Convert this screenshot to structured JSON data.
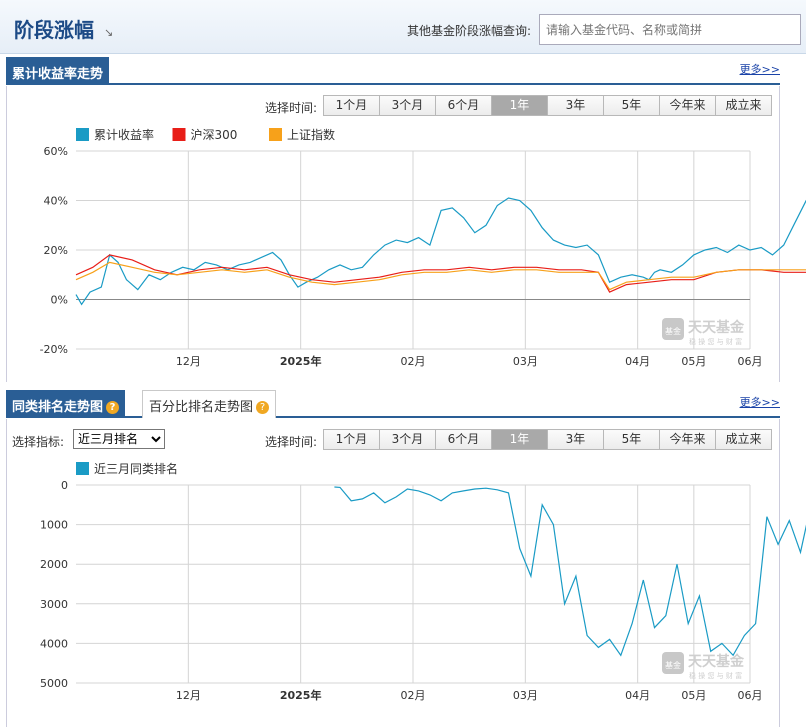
{
  "header": {
    "title": "阶段涨幅",
    "title_arrow": "↘",
    "search_label": "其他基金阶段涨幅查询:",
    "search_placeholder": "请输入基金代码、名称或简拼"
  },
  "section1": {
    "tab": "累计收益率走势",
    "more": "更多>>",
    "time_label": "选择时间:",
    "time_buttons": [
      "1个月",
      "3个月",
      "6个月",
      "1年",
      "3年",
      "5年",
      "今年来",
      "成立来"
    ],
    "active_button": "1年"
  },
  "section2": {
    "tab_active": "同类排名走势图",
    "tab_inactive": "百分比排名走势图",
    "more": "更多>>",
    "indicator_label": "选择指标:",
    "indicator_value": "近三月排名",
    "time_label": "选择时间:",
    "time_buttons": [
      "1个月",
      "3个月",
      "6个月",
      "1年",
      "3年",
      "5年",
      "今年来",
      "成立来"
    ],
    "active_button": "1年"
  },
  "watermark": {
    "brand": "天天基金",
    "badge": "基金",
    "slogan": "稳 操 您 与 财 富"
  },
  "chart_data": [
    {
      "type": "line",
      "legend_position": "top-left",
      "xlim": [
        0,
        12
      ],
      "ylim": [
        -20,
        60
      ],
      "y_ticks": [
        -20,
        0,
        20,
        40,
        60
      ],
      "y_tick_labels": [
        "-20%",
        "0%",
        "20%",
        "40%",
        "60%"
      ],
      "x_ticks": [
        2,
        4,
        6,
        8,
        10,
        11,
        12
      ],
      "x_tick_labels": [
        "12月",
        "2025年",
        "02月",
        "03月",
        "04月",
        "05月",
        "06月"
      ],
      "x_tick_bold": [
        "2025年"
      ],
      "grid": true,
      "series": [
        {
          "name": "累计收益率",
          "color": "#1a9bc5",
          "x": [
            0,
            0.1,
            0.25,
            0.45,
            0.6,
            0.75,
            0.9,
            1.1,
            1.3,
            1.5,
            1.7,
            1.9,
            2.1,
            2.3,
            2.5,
            2.7,
            2.9,
            3.1,
            3.3,
            3.5,
            3.65,
            3.8,
            3.95,
            4.1,
            4.3,
            4.5,
            4.7,
            4.9,
            5.1,
            5.3,
            5.5,
            5.7,
            5.9,
            6.1,
            6.3,
            6.5,
            6.7,
            6.9,
            7.1,
            7.3,
            7.5,
            7.7,
            7.9,
            8.1,
            8.3,
            8.5,
            8.7,
            8.9,
            9.1,
            9.3,
            9.5,
            9.7,
            9.9,
            10.1,
            10.2,
            10.3,
            10.4,
            10.6,
            10.8,
            11.0,
            11.2,
            11.4,
            11.6,
            11.8,
            12.0,
            12.2,
            12.4,
            12.6,
            12.8,
            13.0,
            13.2,
            13.4,
            13.5,
            13.6
          ],
          "y": [
            2,
            -2,
            3,
            5,
            18,
            15,
            8,
            4,
            10,
            8,
            11,
            13,
            12,
            15,
            14,
            12,
            14,
            15,
            17,
            19,
            16,
            10,
            5,
            7,
            9,
            12,
            14,
            12,
            13,
            18,
            22,
            24,
            23,
            25,
            22,
            36,
            37,
            33,
            27,
            30,
            38,
            41,
            40,
            36,
            29,
            24,
            22,
            21,
            22,
            18,
            7,
            9,
            10,
            9,
            8,
            11,
            12,
            11,
            14,
            18,
            20,
            21,
            19,
            22,
            20,
            21,
            18,
            22,
            31,
            40,
            42,
            50,
            58,
            55
          ]
        },
        {
          "name": "沪深300",
          "color": "#e81e18",
          "x": [
            0,
            0.3,
            0.6,
            1.0,
            1.4,
            1.8,
            2.2,
            2.6,
            3.0,
            3.4,
            3.8,
            4.2,
            4.6,
            5.0,
            5.4,
            5.8,
            6.2,
            6.6,
            7.0,
            7.4,
            7.8,
            8.2,
            8.6,
            9.0,
            9.3,
            9.5,
            9.8,
            10.2,
            10.6,
            11.0,
            11.4,
            11.8,
            12.2,
            12.6,
            13.0,
            13.4,
            13.6
          ],
          "y": [
            10,
            13,
            18,
            16,
            12,
            10,
            12,
            13,
            12,
            13,
            10,
            8,
            7,
            8,
            9,
            11,
            12,
            12,
            13,
            12,
            13,
            13,
            12,
            12,
            11,
            3,
            6,
            7,
            8,
            8,
            11,
            12,
            12,
            11,
            11,
            11,
            10
          ]
        },
        {
          "name": "上证指数",
          "color": "#f7a11a",
          "x": [
            0,
            0.3,
            0.6,
            1.0,
            1.4,
            1.8,
            2.2,
            2.6,
            3.0,
            3.4,
            3.8,
            4.2,
            4.6,
            5.0,
            5.4,
            5.8,
            6.2,
            6.6,
            7.0,
            7.4,
            7.8,
            8.2,
            8.6,
            9.0,
            9.3,
            9.5,
            9.8,
            10.2,
            10.6,
            11.0,
            11.4,
            11.8,
            12.2,
            12.6,
            13.0,
            13.4,
            13.6
          ],
          "y": [
            8,
            11,
            15,
            13,
            11,
            10,
            11,
            12,
            11,
            12,
            9,
            7,
            6,
            7,
            8,
            10,
            11,
            11,
            12,
            11,
            12,
            12,
            11,
            11,
            11,
            4,
            7,
            8,
            9,
            9,
            11,
            12,
            12,
            12,
            12,
            12,
            12
          ]
        }
      ]
    },
    {
      "type": "line",
      "legend_position": "top-left",
      "xlim": [
        0,
        12
      ],
      "ylim": [
        0,
        5000
      ],
      "y_inverted": true,
      "y_ticks": [
        0,
        1000,
        2000,
        3000,
        4000,
        5000
      ],
      "y_tick_labels": [
        "0",
        "1000",
        "2000",
        "3000",
        "4000",
        "5000"
      ],
      "x_ticks": [
        2,
        4,
        6,
        8,
        10,
        11,
        12
      ],
      "x_tick_labels": [
        "12月",
        "2025年",
        "02月",
        "03月",
        "04月",
        "05月",
        "06月"
      ],
      "x_tick_bold": [
        "2025年"
      ],
      "grid": true,
      "series": [
        {
          "name": "近三月同类排名",
          "color": "#1a9bc5",
          "x": [
            4.6,
            4.7,
            4.9,
            5.1,
            5.3,
            5.5,
            5.7,
            5.9,
            6.1,
            6.3,
            6.5,
            6.7,
            6.9,
            7.1,
            7.3,
            7.5,
            7.7,
            7.9,
            8.1,
            8.3,
            8.5,
            8.7,
            8.9,
            9.1,
            9.3,
            9.5,
            9.7,
            9.9,
            10.1,
            10.3,
            10.5,
            10.7,
            10.9,
            11.1,
            11.3,
            11.5,
            11.7,
            11.9,
            12.1,
            12.3,
            12.5,
            12.7,
            12.9,
            13.1,
            13.3,
            13.6
          ],
          "y": [
            50,
            60,
            400,
            350,
            200,
            450,
            300,
            100,
            150,
            250,
            400,
            200,
            150,
            100,
            80,
            120,
            200,
            1600,
            2300,
            500,
            1000,
            3000,
            2300,
            3800,
            4100,
            3900,
            4300,
            3500,
            2400,
            3600,
            3300,
            2000,
            3500,
            2800,
            4200,
            4000,
            4300,
            3800,
            3500,
            800,
            1500,
            900,
            1700,
            400,
            150,
            80
          ]
        }
      ]
    }
  ]
}
